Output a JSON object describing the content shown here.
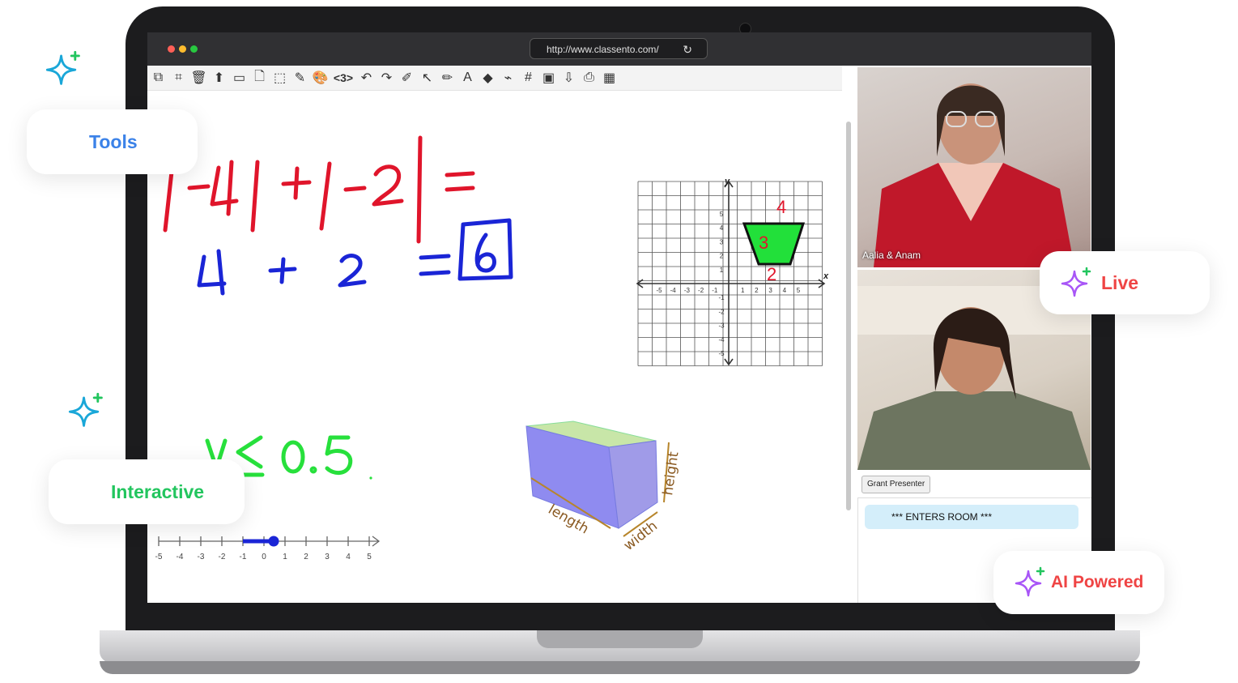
{
  "browser": {
    "url": "http://www.classento.com/",
    "reload_icon": "↻"
  },
  "toolbar": {
    "tools": [
      {
        "name": "select-pages-icon",
        "glyph": "⧉"
      },
      {
        "name": "crop-icon",
        "glyph": "⌗"
      },
      {
        "name": "trash-icon",
        "glyph": "🗑"
      },
      {
        "name": "upload-icon",
        "glyph": "⬆"
      },
      {
        "name": "page-icon",
        "glyph": "▭"
      },
      {
        "name": "new-page-icon",
        "glyph": "🗋"
      },
      {
        "name": "marquee-select-icon",
        "glyph": "⬚"
      },
      {
        "name": "pencil-icon",
        "glyph": "✎"
      },
      {
        "name": "palette-icon",
        "glyph": "🎨"
      },
      {
        "name": "page-counter",
        "glyph": "<3>",
        "text": true
      },
      {
        "name": "undo-icon",
        "glyph": "↶"
      },
      {
        "name": "redo-icon",
        "glyph": "↷"
      },
      {
        "name": "highlighter-icon",
        "glyph": "✐"
      },
      {
        "name": "pointer-icon",
        "glyph": "↖"
      },
      {
        "name": "marker-icon",
        "glyph": "✏"
      },
      {
        "name": "text-icon",
        "glyph": "A"
      },
      {
        "name": "shapes-icon",
        "glyph": "◆"
      },
      {
        "name": "link-icon",
        "glyph": "⌁"
      },
      {
        "name": "grid-icon",
        "glyph": "#"
      },
      {
        "name": "screen-share-icon",
        "glyph": "▣"
      },
      {
        "name": "download-icon",
        "glyph": "⇩"
      },
      {
        "name": "print-icon",
        "glyph": "⎙"
      },
      {
        "name": "calculator-icon",
        "glyph": "▦"
      }
    ]
  },
  "whiteboard": {
    "equation1_parts": [
      "|-4|",
      "+",
      "|-2|",
      "="
    ],
    "equation2_parts": [
      "4",
      "+",
      "2",
      "=",
      "6"
    ],
    "inequality": "y ≤ 0.5",
    "number_line_ticks": [
      "-5",
      "-4",
      "-3",
      "-2",
      "-1",
      "0",
      "1",
      "2",
      "3",
      "4",
      "5"
    ],
    "grid_x_ticks": [
      "-5",
      "-4",
      "-3",
      "-2",
      "-1",
      "1",
      "2",
      "3",
      "4",
      "5"
    ],
    "grid_y_ticks": [
      "5",
      "4",
      "3",
      "2",
      "1",
      "-1",
      "-2",
      "-3",
      "-4",
      "-5"
    ],
    "grid_x_label": "x",
    "grid_y_label": "y",
    "trapezoid_labels": [
      "4",
      "3",
      "2"
    ],
    "prism_labels": {
      "length": "length",
      "width": "width",
      "height": "height"
    }
  },
  "videos": [
    {
      "label": "Aalia & Anam"
    },
    {
      "label": ""
    }
  ],
  "grant_presenter": "Grant Presenter",
  "chat_message": "*** ENTERS ROOM ***",
  "pills": {
    "tools": "Tools",
    "interactive": "Interactive",
    "live": "Live",
    "ai": "AI Powered"
  },
  "colors": {
    "tools_blue": "#3b82e8",
    "interactive_green": "#22c55e",
    "live_red": "#ef4444",
    "ai_red": "#ef4444",
    "ink_red": "#e0152b",
    "ink_blue": "#1a25d6",
    "ink_green": "#27e03c",
    "trapezoid_fill": "#22e03a"
  }
}
